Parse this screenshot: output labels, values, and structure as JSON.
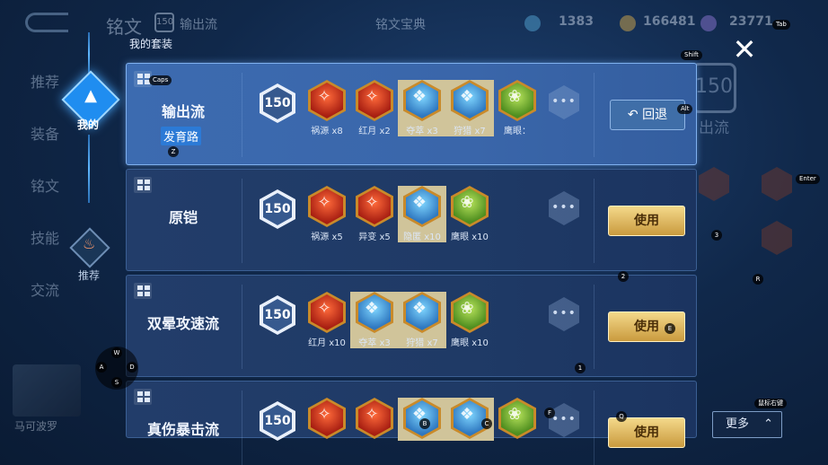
{
  "background": {
    "title": "铭文",
    "level": "150",
    "subtitle": "输出流",
    "subtitle2": "铭文宝典",
    "currency1": "1383",
    "currency2": "166481",
    "currency3": "23771",
    "left_items": [
      "推荐",
      "装备",
      "铭文",
      "技能",
      "交流"
    ],
    "right_level": "150",
    "right_label": "出流",
    "hero_name": "马可波罗"
  },
  "nav": {
    "my_label": "我的",
    "recommend_label": "推荐"
  },
  "panel": {
    "title": "我的套装",
    "sets": [
      {
        "name": "输出流",
        "tag": "发育路",
        "level": "150",
        "active": true,
        "action": "回退",
        "runes": [
          {
            "color": "red",
            "label": "祸源 x8"
          },
          {
            "color": "red",
            "label": "红月 x2"
          },
          {
            "color": "blue",
            "label": "夺萃 x3"
          },
          {
            "color": "blue",
            "label": "狩猎 x7"
          },
          {
            "color": "green",
            "label": "鹰眼："
          }
        ]
      },
      {
        "name": "原铠",
        "tag": "",
        "level": "150",
        "active": false,
        "action": "使用",
        "runes": [
          {
            "color": "red",
            "label": "祸源 x5"
          },
          {
            "color": "red",
            "label": "异变 x5"
          },
          {
            "color": "blue",
            "label": "隐匿 x10"
          },
          {
            "color": "green",
            "label": "鹰眼 x10"
          }
        ]
      },
      {
        "name": "双晕攻速流",
        "tag": "",
        "level": "150",
        "active": false,
        "action": "使用",
        "runes": [
          {
            "color": "red",
            "label": "红月 x10"
          },
          {
            "color": "blue",
            "label": "夺萃 x3"
          },
          {
            "color": "blue",
            "label": "狩猎 x7"
          },
          {
            "color": "green",
            "label": "鹰眼 x10"
          }
        ]
      },
      {
        "name": "真伤暴击流",
        "tag": "",
        "level": "150",
        "active": false,
        "action": "使用",
        "runes": [
          {
            "color": "red",
            "label": ""
          },
          {
            "color": "red",
            "label": ""
          },
          {
            "color": "blue",
            "label": ""
          },
          {
            "color": "blue",
            "label": ""
          },
          {
            "color": "green",
            "label": ""
          }
        ]
      }
    ]
  },
  "overlay": {
    "close_symbol": "✕",
    "more_label": "更多",
    "keys": {
      "tab": "Tab",
      "shift": "Shift",
      "caps": "Caps",
      "alt": "Alt",
      "enter": "Enter",
      "z": "Z",
      "w": "W",
      "a": "A",
      "s": "S",
      "d": "D",
      "n2": "2",
      "n3": "3",
      "n1": "1",
      "r": "R",
      "e": "E",
      "f": "F",
      "q": "Q",
      "b": "B",
      "c": "C",
      "mouse": "鼠标右键"
    }
  },
  "colors": {
    "accent": "#1f8df0",
    "gold": "#d9b35a",
    "panel": "#1f3a66",
    "panel_active": "#3a66aa"
  }
}
